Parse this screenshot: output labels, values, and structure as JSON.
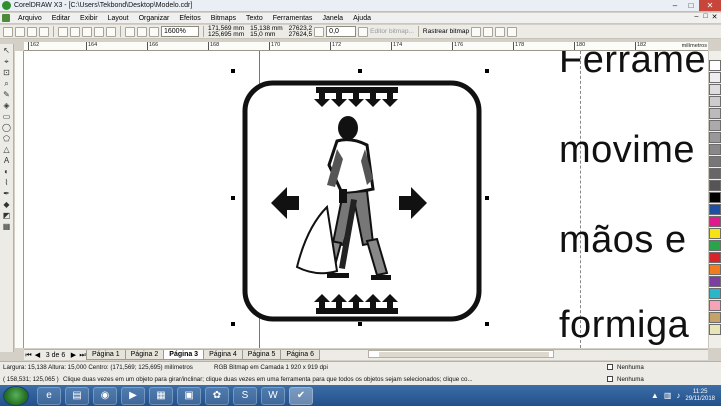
{
  "window": {
    "title": "CorelDRAW X3 - [C:\\Users\\Tekbond\\Desktop\\Modelo.cdr]",
    "controls": [
      "–",
      "□",
      "✕"
    ]
  },
  "menu": [
    "Arquivo",
    "Editar",
    "Exibir",
    "Layout",
    "Organizar",
    "Efeitos",
    "Bitmaps",
    "Texto",
    "Ferramentas",
    "Janela",
    "Ajuda"
  ],
  "toolbar": {
    "zoom": "1600%",
    "pos_x": "171,569 mm",
    "pos_y": "125,695 mm",
    "width": "15,138 mm",
    "height": "15,0 mm",
    "scale_x": "27623,2",
    "scale_y": "27624,5",
    "angle": "0,0",
    "edit_bitmap": "Editor bitmap...",
    "trace_bitmap": "Rastrear bitmap"
  },
  "ruler": {
    "ticks": [
      "162",
      "164",
      "166",
      "168",
      "170",
      "172",
      "174",
      "176",
      "178",
      "180",
      "182"
    ],
    "unit": "milímetros"
  },
  "canvas": {
    "text_lines": [
      "Ferrame",
      "movime",
      "mãos e",
      "formiga"
    ]
  },
  "pages": {
    "counter": "3 de 6",
    "tabs": [
      "Página 1",
      "Página 2",
      "Página 3",
      "Página 4",
      "Página 5",
      "Página 6"
    ],
    "active_index": 2
  },
  "status": {
    "dimensions": "Largura: 15,138  Altura: 15,000  Centro: (171,569; 125,695)  milímetros",
    "object_info": "RGB Bitmap em Camada 1 920 x 919 dpi",
    "coords": "( 158,531; 125,065 )",
    "hint": "Clique duas vezes em um objeto para girar/inclinar; clique duas vezes em uma ferramenta para que todos os objetos sejam selecionados; clique co...",
    "fill_label": "Nenhuma",
    "outline_label": "Nenhuma"
  },
  "palette_colors": [
    "#ffffff",
    "#eeeeee",
    "#dddddd",
    "#cccccc",
    "#bbbbbb",
    "#aaaaaa",
    "#999999",
    "#888888",
    "#777777",
    "#666666",
    "#555555",
    "#000000",
    "#1f4fa5",
    "#e01a8c",
    "#f5e313",
    "#2aa34a",
    "#d9232a",
    "#f07c1e",
    "#7a3fa0",
    "#2bb5c9",
    "#f6a2b8",
    "#c4a26a",
    "#e8e6b8"
  ],
  "taskbar": {
    "apps": [
      "ie-icon",
      "folder-icon",
      "chrome-icon",
      "media-icon",
      "calc-icon",
      "window-icon",
      "green-icon",
      "skype-icon",
      "word-icon",
      "coreldraw-icon"
    ],
    "time": "11:25",
    "date": "29/11/2018"
  }
}
